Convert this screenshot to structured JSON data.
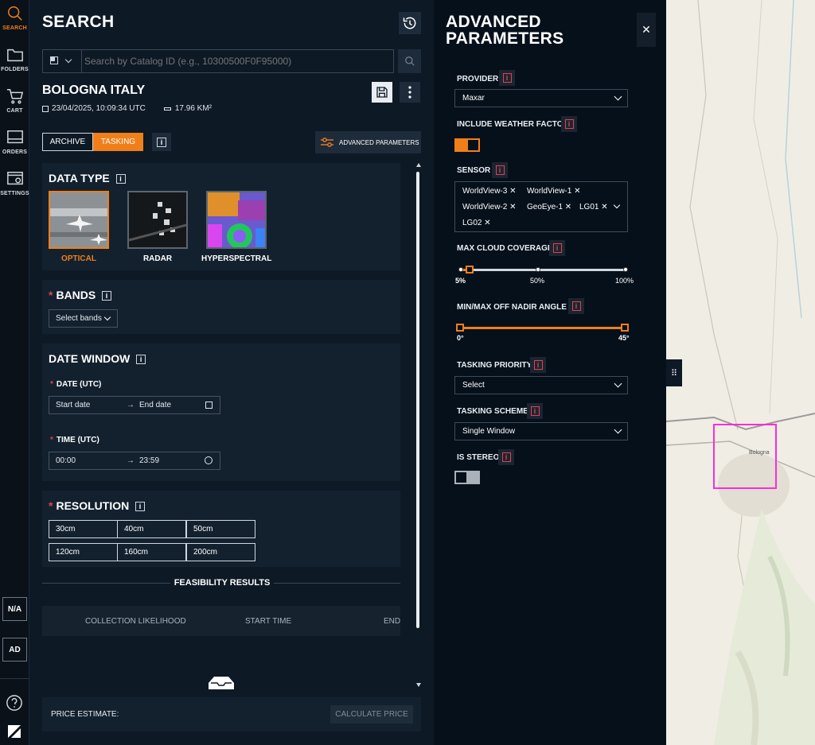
{
  "nav": {
    "search": "SEARCH",
    "folders": "FOLDERS",
    "cart": "CART",
    "orders": "ORDERS",
    "settings": "SETTINGS",
    "na": "N/A",
    "avatar": "AD"
  },
  "search": {
    "title": "SEARCH",
    "placeholder": "Search by Catalog ID (e.g., 10300500F0F95000)",
    "aoi": {
      "name": "BOLOGNA ITALY",
      "date": "23/04/2025, 10:09:34 UTC",
      "area": "17.96 KM²"
    },
    "tabs": {
      "archive": "ARCHIVE",
      "tasking": "TASKING",
      "active": "TASKING"
    },
    "advanced_button": "ADVANCED PARAMETERS",
    "data_type": {
      "title": "DATA TYPE",
      "items": [
        {
          "label": "OPTICAL",
          "selected": true
        },
        {
          "label": "RADAR",
          "selected": false
        },
        {
          "label": "HYPERSPECTRAL",
          "selected": false
        }
      ]
    },
    "bands": {
      "title": "BANDS",
      "select": "Select bands"
    },
    "date_window": {
      "title": "DATE WINDOW",
      "date_label": "DATE (UTC)",
      "start_placeholder": "Start date",
      "end_placeholder": "End date",
      "time_label": "TIME (UTC)",
      "start_time": "00:00",
      "end_time": "23:59"
    },
    "resolution": {
      "title": "RESOLUTION",
      "options": [
        "30cm",
        "40cm",
        "50cm",
        "120cm",
        "160cm",
        "200cm"
      ]
    },
    "feasibility": {
      "title": "FEASIBILITY RESULTS",
      "columns": [
        "COLLECTION LIKELIHOOD",
        "START TIME",
        "END"
      ]
    },
    "price": {
      "label": "PRICE ESTIMATE:",
      "button": "CALCULATE PRICE"
    }
  },
  "advanced": {
    "title_line1": "ADVANCED",
    "title_line2": "PARAMETERS",
    "provider": {
      "label": "PROVIDER",
      "value": "Maxar"
    },
    "weather": {
      "label": "INCLUDE WEATHER FACTOR",
      "on": true
    },
    "sensor": {
      "label": "SENSOR",
      "tags": [
        "WorldView-3",
        "WorldView-1",
        "WorldView-2",
        "GeoEye-1",
        "LG01",
        "LG02"
      ]
    },
    "cloud": {
      "label": "MAX CLOUD COVERAGE",
      "value": 10,
      "ticks": [
        "5%",
        "50%",
        "100%"
      ]
    },
    "nadir": {
      "label": "MIN/MAX OFF NADIR ANGLE",
      "min": "0°",
      "max": "45°"
    },
    "priority": {
      "label": "TASKING PRIORITY",
      "value": "Select"
    },
    "scheme": {
      "label": "TASKING SCHEME",
      "value": "Single Window"
    },
    "stereo": {
      "label": "IS STEREO",
      "on": false
    },
    "accent": "#f07f1a",
    "info_color": "#e0424f"
  },
  "map": {
    "aoi_color": "#ff2bd6",
    "city_label": "Bologna"
  }
}
